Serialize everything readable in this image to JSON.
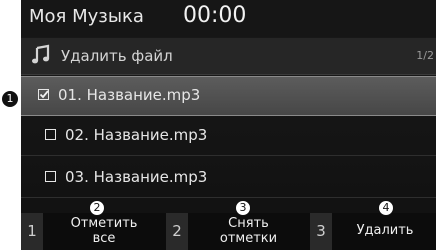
{
  "header": {
    "app_title": "Моя Музыка",
    "clock": "00:00"
  },
  "subheader": {
    "icon": "music-note-icon",
    "mode_label": "Удалить файл",
    "page_indicator": "1/2"
  },
  "files": [
    {
      "name": "01. Название.mp3",
      "checked": true,
      "selected": true
    },
    {
      "name": "02. Название.mp3",
      "checked": false,
      "selected": false
    },
    {
      "name": "03. Название.mp3",
      "checked": false,
      "selected": false
    }
  ],
  "softkeys": [
    {
      "number": "1",
      "label_line1": "Отметить",
      "label_line2": "все"
    },
    {
      "number": "2",
      "label_line1": "Снять",
      "label_line2": "отметки"
    },
    {
      "number": "3",
      "label_line1": "Удалить",
      "label_line2": ""
    }
  ],
  "callouts": {
    "c1": "1",
    "c2": "2",
    "c3": "3",
    "c4": "4"
  },
  "colors": {
    "background": "#111111",
    "selected_row": "#555555",
    "text": "#e6e6e6"
  }
}
